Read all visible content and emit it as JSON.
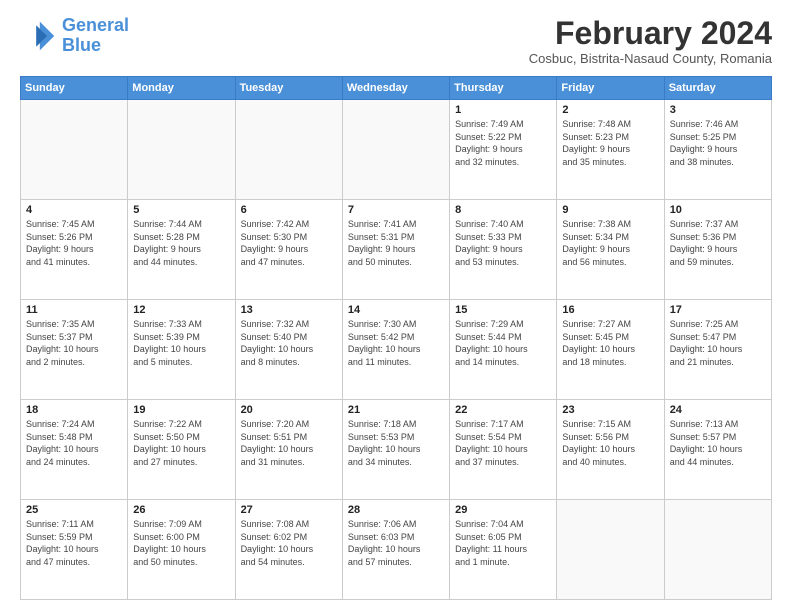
{
  "logo": {
    "line1": "General",
    "line2": "Blue"
  },
  "title": "February 2024",
  "subtitle": "Cosbuc, Bistrita-Nasaud County, Romania",
  "days_header": [
    "Sunday",
    "Monday",
    "Tuesday",
    "Wednesday",
    "Thursday",
    "Friday",
    "Saturday"
  ],
  "weeks": [
    [
      {
        "day": "",
        "info": ""
      },
      {
        "day": "",
        "info": ""
      },
      {
        "day": "",
        "info": ""
      },
      {
        "day": "",
        "info": ""
      },
      {
        "day": "1",
        "info": "Sunrise: 7:49 AM\nSunset: 5:22 PM\nDaylight: 9 hours\nand 32 minutes."
      },
      {
        "day": "2",
        "info": "Sunrise: 7:48 AM\nSunset: 5:23 PM\nDaylight: 9 hours\nand 35 minutes."
      },
      {
        "day": "3",
        "info": "Sunrise: 7:46 AM\nSunset: 5:25 PM\nDaylight: 9 hours\nand 38 minutes."
      }
    ],
    [
      {
        "day": "4",
        "info": "Sunrise: 7:45 AM\nSunset: 5:26 PM\nDaylight: 9 hours\nand 41 minutes."
      },
      {
        "day": "5",
        "info": "Sunrise: 7:44 AM\nSunset: 5:28 PM\nDaylight: 9 hours\nand 44 minutes."
      },
      {
        "day": "6",
        "info": "Sunrise: 7:42 AM\nSunset: 5:30 PM\nDaylight: 9 hours\nand 47 minutes."
      },
      {
        "day": "7",
        "info": "Sunrise: 7:41 AM\nSunset: 5:31 PM\nDaylight: 9 hours\nand 50 minutes."
      },
      {
        "day": "8",
        "info": "Sunrise: 7:40 AM\nSunset: 5:33 PM\nDaylight: 9 hours\nand 53 minutes."
      },
      {
        "day": "9",
        "info": "Sunrise: 7:38 AM\nSunset: 5:34 PM\nDaylight: 9 hours\nand 56 minutes."
      },
      {
        "day": "10",
        "info": "Sunrise: 7:37 AM\nSunset: 5:36 PM\nDaylight: 9 hours\nand 59 minutes."
      }
    ],
    [
      {
        "day": "11",
        "info": "Sunrise: 7:35 AM\nSunset: 5:37 PM\nDaylight: 10 hours\nand 2 minutes."
      },
      {
        "day": "12",
        "info": "Sunrise: 7:33 AM\nSunset: 5:39 PM\nDaylight: 10 hours\nand 5 minutes."
      },
      {
        "day": "13",
        "info": "Sunrise: 7:32 AM\nSunset: 5:40 PM\nDaylight: 10 hours\nand 8 minutes."
      },
      {
        "day": "14",
        "info": "Sunrise: 7:30 AM\nSunset: 5:42 PM\nDaylight: 10 hours\nand 11 minutes."
      },
      {
        "day": "15",
        "info": "Sunrise: 7:29 AM\nSunset: 5:44 PM\nDaylight: 10 hours\nand 14 minutes."
      },
      {
        "day": "16",
        "info": "Sunrise: 7:27 AM\nSunset: 5:45 PM\nDaylight: 10 hours\nand 18 minutes."
      },
      {
        "day": "17",
        "info": "Sunrise: 7:25 AM\nSunset: 5:47 PM\nDaylight: 10 hours\nand 21 minutes."
      }
    ],
    [
      {
        "day": "18",
        "info": "Sunrise: 7:24 AM\nSunset: 5:48 PM\nDaylight: 10 hours\nand 24 minutes."
      },
      {
        "day": "19",
        "info": "Sunrise: 7:22 AM\nSunset: 5:50 PM\nDaylight: 10 hours\nand 27 minutes."
      },
      {
        "day": "20",
        "info": "Sunrise: 7:20 AM\nSunset: 5:51 PM\nDaylight: 10 hours\nand 31 minutes."
      },
      {
        "day": "21",
        "info": "Sunrise: 7:18 AM\nSunset: 5:53 PM\nDaylight: 10 hours\nand 34 minutes."
      },
      {
        "day": "22",
        "info": "Sunrise: 7:17 AM\nSunset: 5:54 PM\nDaylight: 10 hours\nand 37 minutes."
      },
      {
        "day": "23",
        "info": "Sunrise: 7:15 AM\nSunset: 5:56 PM\nDaylight: 10 hours\nand 40 minutes."
      },
      {
        "day": "24",
        "info": "Sunrise: 7:13 AM\nSunset: 5:57 PM\nDaylight: 10 hours\nand 44 minutes."
      }
    ],
    [
      {
        "day": "25",
        "info": "Sunrise: 7:11 AM\nSunset: 5:59 PM\nDaylight: 10 hours\nand 47 minutes."
      },
      {
        "day": "26",
        "info": "Sunrise: 7:09 AM\nSunset: 6:00 PM\nDaylight: 10 hours\nand 50 minutes."
      },
      {
        "day": "27",
        "info": "Sunrise: 7:08 AM\nSunset: 6:02 PM\nDaylight: 10 hours\nand 54 minutes."
      },
      {
        "day": "28",
        "info": "Sunrise: 7:06 AM\nSunset: 6:03 PM\nDaylight: 10 hours\nand 57 minutes."
      },
      {
        "day": "29",
        "info": "Sunrise: 7:04 AM\nSunset: 6:05 PM\nDaylight: 11 hours\nand 1 minute."
      },
      {
        "day": "",
        "info": ""
      },
      {
        "day": "",
        "info": ""
      }
    ]
  ]
}
